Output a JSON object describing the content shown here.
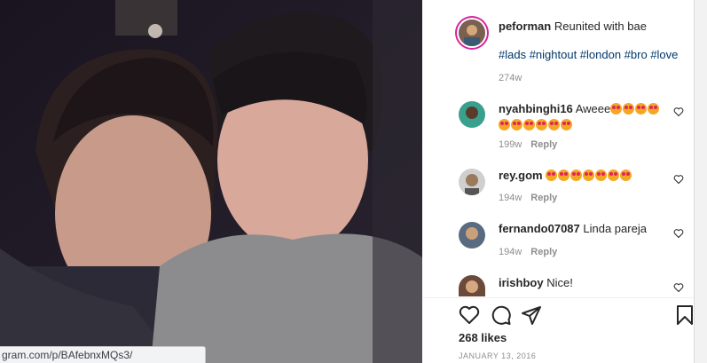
{
  "post": {
    "username": "peforman",
    "caption": "Reunited with bae",
    "hashtags": "#lads #nightout #london #bro #love",
    "age": "274w",
    "likes": "268 likes",
    "date": "JANUARY 13, 2016"
  },
  "comments": [
    {
      "username": "nyahbinghi16",
      "text": "Aweee",
      "emoji_count": 10,
      "age": "199w",
      "reply_label": "Reply"
    },
    {
      "username": "rey.gom",
      "text": "",
      "emoji_count": 7,
      "age": "194w",
      "reply_label": "Reply"
    },
    {
      "username": "fernando07087",
      "text": "Linda pareja",
      "emoji_count": 0,
      "age": "194w",
      "reply_label": "Reply"
    },
    {
      "username": "irishboy",
      "text": "Nice!",
      "emoji_count": 0,
      "age": "",
      "reply_label": ""
    }
  ],
  "icons": [
    "heart-icon",
    "comment-icon",
    "share-icon",
    "bookmark-icon"
  ],
  "status_url": "gram.com/p/BAfebnxMQs3/",
  "colors": {
    "link": "#00376b",
    "muted": "#8e8e8e",
    "ring": "#d6249f"
  }
}
